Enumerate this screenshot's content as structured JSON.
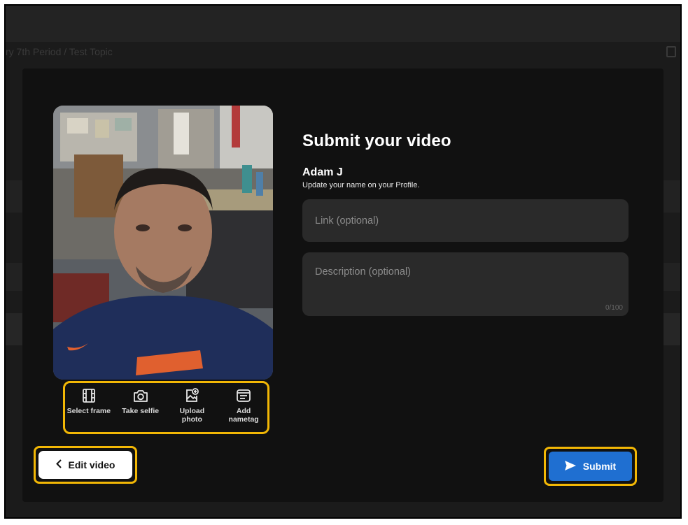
{
  "background": {
    "breadcrumb": "ry 7th Period  /  Test Topic"
  },
  "modal": {
    "title": "Submit your video",
    "user_name": "Adam J",
    "name_hint": "Update your name on your Profile.",
    "link_placeholder": "Link (optional)",
    "description_placeholder": "Description (optional)",
    "description_counter": "0/100"
  },
  "tools": [
    {
      "icon": "film-frame-icon",
      "label": "Select frame"
    },
    {
      "icon": "camera-icon",
      "label": "Take selfie"
    },
    {
      "icon": "upload-photo-icon",
      "label": "Upload photo"
    },
    {
      "icon": "nametag-icon",
      "label": "Add nametag"
    }
  ],
  "buttons": {
    "edit_video": "Edit video",
    "submit": "Submit"
  },
  "colors": {
    "modal_bg": "#111111",
    "field_bg": "#2a2a2a",
    "highlight": "#f2b705",
    "submit_bg": "#1f6fd1"
  }
}
